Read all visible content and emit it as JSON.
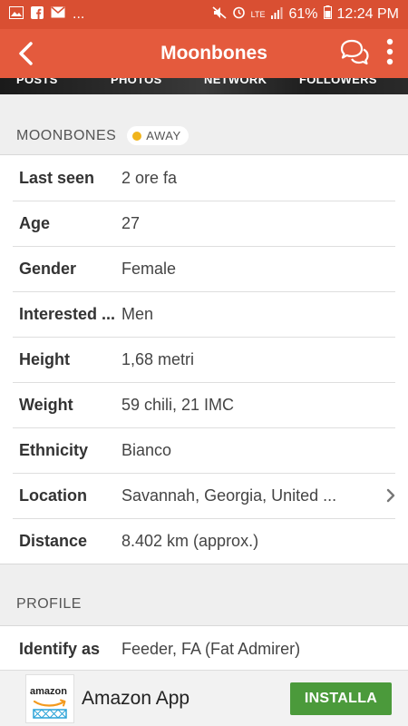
{
  "status_bar": {
    "dots": "...",
    "network": "LTE",
    "battery": "61%",
    "time": "12:24 PM"
  },
  "app_bar": {
    "title": "Moonbones"
  },
  "tabs": [
    "POSTS",
    "PHOTOS",
    "NETWORK",
    "FOLLOWERS"
  ],
  "user_section": {
    "heading": "MOONBONES",
    "status": "AWAY",
    "status_color": "#f0b41c"
  },
  "details": [
    {
      "label": "Last seen",
      "value": "2 ore fa"
    },
    {
      "label": "Age",
      "value": "27"
    },
    {
      "label": "Gender",
      "value": "Female"
    },
    {
      "label": "Interested ...",
      "value": "Men"
    },
    {
      "label": "Height",
      "value": "1,68 metri"
    },
    {
      "label": "Weight",
      "value": "59 chili, 21 IMC"
    },
    {
      "label": "Ethnicity",
      "value": "Bianco"
    },
    {
      "label": "Location",
      "value": "Savannah, Georgia, United ..."
    },
    {
      "label": "Distance",
      "value": "8.402 km (approx.)"
    }
  ],
  "profile_section": {
    "heading": "PROFILE",
    "rows": [
      {
        "label": "Identify as",
        "value": "Feeder, FA (Fat Admirer)"
      }
    ]
  },
  "ad": {
    "logo_text": "amazon",
    "app_name": "Amazon App",
    "install_label": "INSTALLA"
  },
  "colors": {
    "status_bar": "#d94f32",
    "app_bar": "#e45a3d",
    "install": "#4b9a3b"
  }
}
